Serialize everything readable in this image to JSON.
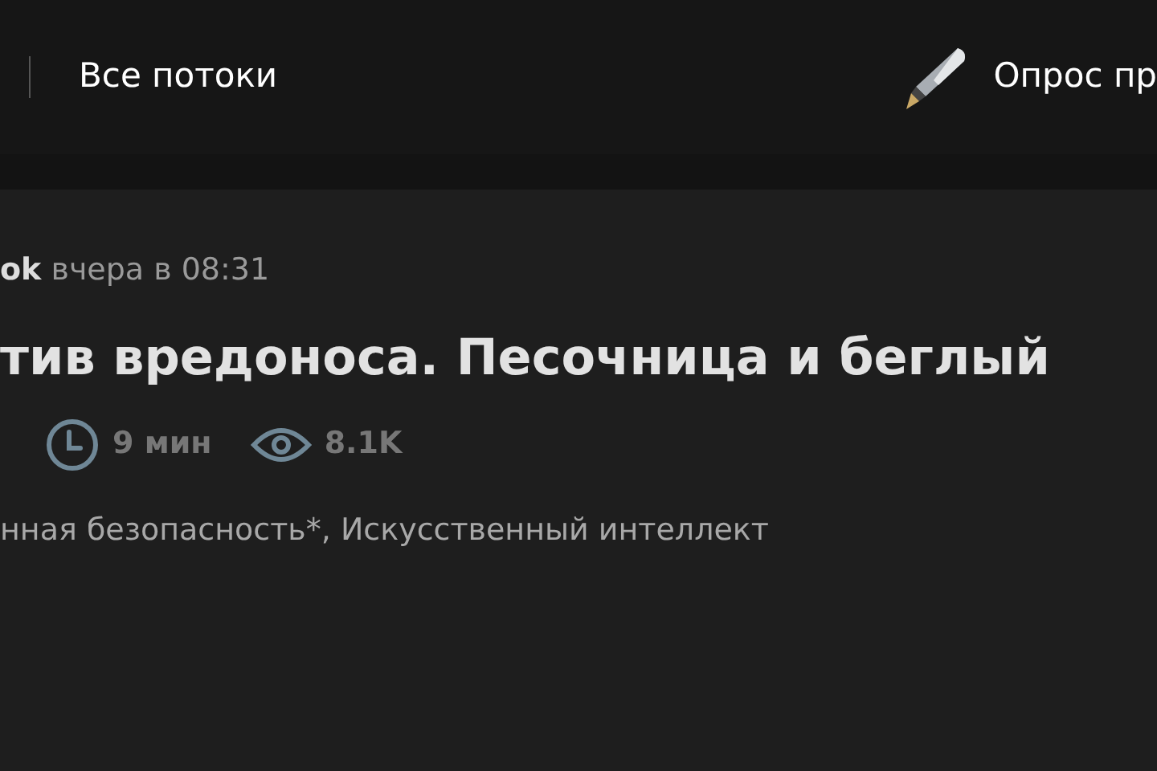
{
  "header": {
    "nav_link": "Все потоки",
    "poll_link": "Опрос пр"
  },
  "article": {
    "author": "ok",
    "time": "вчера в 08:31",
    "title": "тив вредоноса. Песочница и беглый",
    "reading_time": "9 мин",
    "views": "8.1K",
    "hubs": "нная безопасность*, Искусственный интеллект"
  }
}
